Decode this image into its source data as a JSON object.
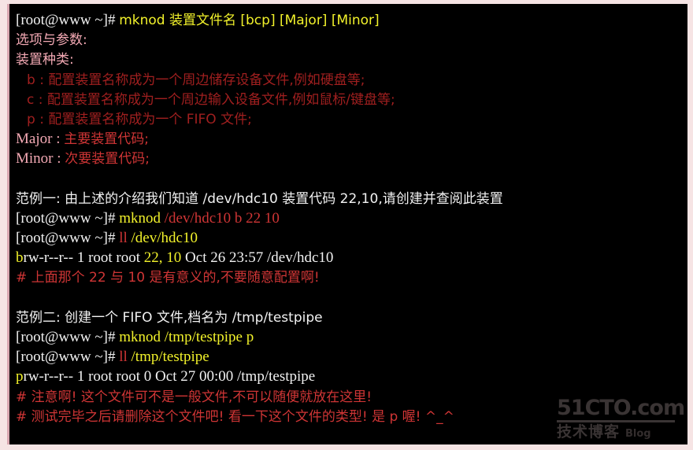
{
  "colors": {
    "background": "#000000",
    "frame": "#f6e4e4",
    "left_rail": "#d9a7b0",
    "white": "#f2f2f2",
    "yellow": "#f2f22b",
    "pink": "#f3a9b4",
    "red": "#cf3535",
    "dark_red": "#a01f1f",
    "watermark": "#3a3434"
  },
  "terminal": {
    "prompt": "[root@www ~]#",
    "lines": [
      {
        "id": "usage-command",
        "segments": [
          {
            "text": "[root@www ~]# ",
            "color": "white"
          },
          {
            "text": "mknod 装置文件名 [bcp] [Major] [Minor]",
            "color": "yellow"
          }
        ]
      },
      {
        "id": "options-heading",
        "segments": [
          {
            "text": "选项与参数:",
            "color": "pink"
          }
        ]
      },
      {
        "id": "device-types-heading",
        "segments": [
          {
            "text": "装置种类:",
            "color": "pink"
          }
        ]
      },
      {
        "id": "opt-b",
        "indent": 1,
        "segments": [
          {
            "text": "b : 配置装置名称成为一个周边储存设备文件,例如硬盘等;",
            "color": "dark_red"
          }
        ]
      },
      {
        "id": "opt-c",
        "indent": 1,
        "segments": [
          {
            "text": "c : 配置装置名称成为一个周边输入设备文件,例如鼠标/键盘等;",
            "color": "dark_red"
          }
        ]
      },
      {
        "id": "opt-p",
        "indent": 1,
        "segments": [
          {
            "text": "p : 配置装置名称成为一个 FIFO 文件;",
            "color": "dark_red"
          }
        ]
      },
      {
        "id": "opt-major",
        "segments": [
          {
            "text": "Major",
            "color": "pink"
          },
          {
            "text": " : ",
            "color": "pink"
          },
          {
            "text": "主要装置代码;",
            "color": "red"
          }
        ]
      },
      {
        "id": "opt-minor",
        "segments": [
          {
            "text": "Minor",
            "color": "pink"
          },
          {
            "text": " : ",
            "color": "pink"
          },
          {
            "text": "次要装置代码;",
            "color": "red"
          }
        ]
      },
      {
        "id": "blank-1",
        "segments": []
      },
      {
        "id": "example-1-title",
        "segments": [
          {
            "text": "范例一: 由上述的介绍我们知道 /dev/hdc10 装置代码 22,10,请创建并查阅此装置",
            "color": "white"
          }
        ]
      },
      {
        "id": "example-1-mknod",
        "segments": [
          {
            "text": "[root@www ~]# ",
            "color": "white"
          },
          {
            "text": "mknod ",
            "color": "yellow"
          },
          {
            "text": "/dev/hdc10 b 22 10",
            "color": "red"
          }
        ]
      },
      {
        "id": "example-1-ll",
        "segments": [
          {
            "text": "[root@www ~]# ",
            "color": "white"
          },
          {
            "text": "ll ",
            "color": "red"
          },
          {
            "text": "/dev/hdc10",
            "color": "yellow"
          }
        ]
      },
      {
        "id": "example-1-output",
        "segments": [
          {
            "text": "b",
            "color": "yellow"
          },
          {
            "text": "rw-r--r-- 1 root root ",
            "color": "white"
          },
          {
            "text": "22, 10",
            "color": "yellow"
          },
          {
            "text": " Oct 26 23:57 /dev/hdc10",
            "color": "white"
          }
        ]
      },
      {
        "id": "example-1-comment",
        "segments": [
          {
            "text": "# 上面那个 22 与 10 是有意义的,不要随意配置啊!",
            "color": "red"
          }
        ]
      },
      {
        "id": "blank-2",
        "segments": []
      },
      {
        "id": "example-2-title",
        "segments": [
          {
            "text": "范例二: 创建一个 FIFO 文件,档名为 /tmp/testpipe",
            "color": "white"
          }
        ]
      },
      {
        "id": "example-2-mknod",
        "segments": [
          {
            "text": "[root@www ~]# ",
            "color": "white"
          },
          {
            "text": "mknod /tmp/testpipe p",
            "color": "yellow"
          }
        ]
      },
      {
        "id": "example-2-ll",
        "segments": [
          {
            "text": "[root@www ~]# ",
            "color": "white"
          },
          {
            "text": "ll ",
            "color": "red"
          },
          {
            "text": "/tmp/testpipe",
            "color": "yellow"
          }
        ]
      },
      {
        "id": "example-2-output",
        "segments": [
          {
            "text": "p",
            "color": "yellow"
          },
          {
            "text": "rw-r--r-- 1 root root 0 Oct 27 00:00 /tmp/testpipe",
            "color": "white"
          }
        ]
      },
      {
        "id": "example-2-comment-1",
        "segments": [
          {
            "text": "# 注意啊! 这个文件可不是一般文件,不可以随便就放在这里!",
            "color": "red"
          }
        ]
      },
      {
        "id": "example-2-comment-2",
        "segments": [
          {
            "text": "# 测试完毕之后请删除这个文件吧! 看一下这个文件的类型! 是 p 喔! ^_^",
            "color": "red"
          }
        ]
      }
    ]
  },
  "watermark": {
    "site": "51CTO.com",
    "subtitle": "技术博客",
    "blog": "Blog"
  }
}
